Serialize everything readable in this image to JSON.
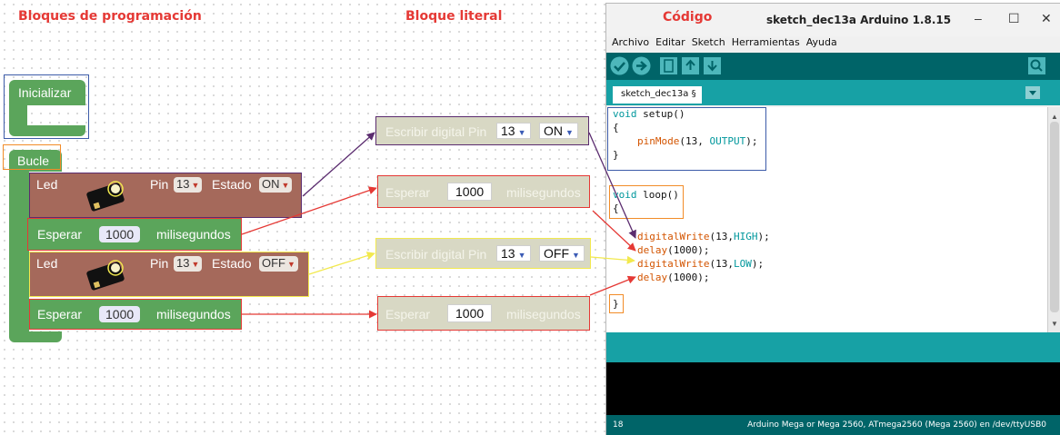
{
  "headings": {
    "blocks": "Bloques de programación",
    "literal": "Bloque literal",
    "code": "Código"
  },
  "blocks": {
    "init": "Inicializar",
    "loop": "Bucle",
    "led1": {
      "label": "Led",
      "pin_label": "Pin",
      "pin": "13",
      "state_label": "Estado",
      "state": "ON"
    },
    "wait1": {
      "label": "Esperar",
      "value": "1000",
      "unit": "milisegundos"
    },
    "led2": {
      "label": "Led",
      "pin_label": "Pin",
      "pin": "13",
      "state_label": "Estado",
      "state": "OFF"
    },
    "wait2": {
      "label": "Esperar",
      "value": "1000",
      "unit": "milisegundos"
    }
  },
  "literal": {
    "write1": {
      "label": "Escribir digital Pin",
      "pin": "13",
      "state": "ON"
    },
    "wait1": {
      "label": "Esperar",
      "value": "1000",
      "unit": "milisegundos"
    },
    "write2": {
      "label": "Escribir digital Pin",
      "pin": "13",
      "state": "OFF"
    },
    "wait2": {
      "label": "Esperar",
      "value": "1000",
      "unit": "milisegundos"
    }
  },
  "ide": {
    "title": "sketch_dec13a Arduino 1.8.15",
    "menu": [
      "Archivo",
      "Editar",
      "Sketch",
      "Herramientas",
      "Ayuda"
    ],
    "tab": "sketch_dec13a §",
    "footer_line": "18",
    "footer_board": "Arduino Mega or Mega 2560, ATmega2560 (Mega 2560) en /dev/ttyUSB0",
    "code": {
      "l1a": "void",
      "l1b": " setup()",
      "l2": "{",
      "l3a": "pinMode",
      "l3b": "(13, ",
      "l3c": "OUTPUT",
      "l3d": ");",
      "l4": "}",
      "l5a": "void",
      "l5b": " loop()",
      "l6": "{",
      "l7a": "digitalWrite",
      "l7b": "(13,",
      "l7c": "HIGH",
      "l7d": ");",
      "l8a": "delay",
      "l8b": "(1000);",
      "l9a": "digitalWrite",
      "l9b": "(13,",
      "l9c": "LOW",
      "l9d": ");",
      "l10a": "delay",
      "l10b": "(1000);",
      "l11": "}"
    }
  },
  "colors": {
    "accent_red": "#e53935",
    "blue": "#3c5ba8",
    "orange": "#f28c28",
    "purple": "#5b2c6f",
    "yellow": "#f2e94e",
    "teal": "#006468"
  }
}
